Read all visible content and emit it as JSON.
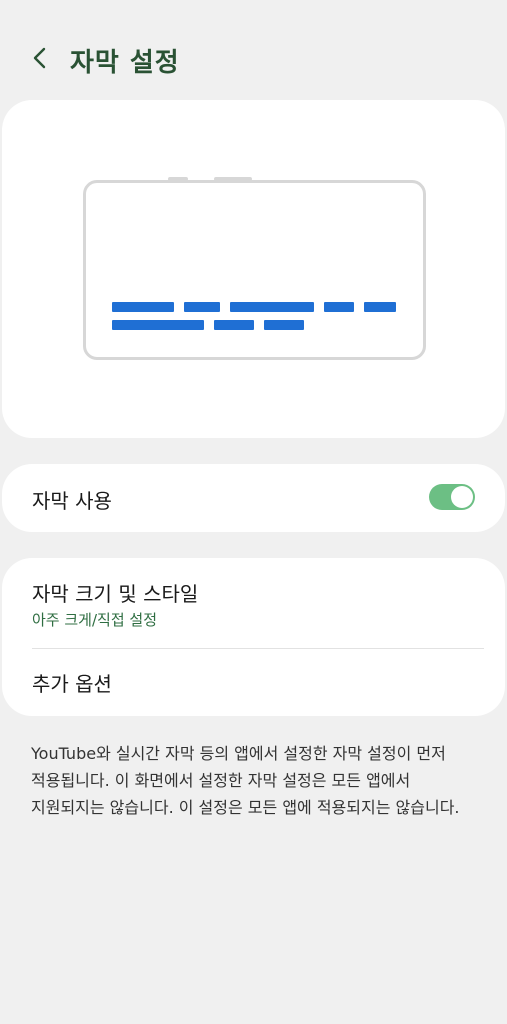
{
  "header": {
    "title": "자막 설정",
    "back_icon": "chevron-left-icon"
  },
  "toggle_row": {
    "label": "자막 사용",
    "enabled": true,
    "toggle_color": "#6cbf84"
  },
  "options": [
    {
      "label": "자막 크기 및 스타일",
      "sublabel": "아주 크게/직접 설정"
    },
    {
      "label": "추가 옵션"
    }
  ],
  "note": "YouTube와 실시간 자막 등의 앱에서 설정한 자막 설정이 먼저 적용됩니다. 이 화면에서 설정한 자막 설정은 모든 앱에서 지원되지는 않습니다. 이 설정은 모든 앱에 적용되지는 않습니다.",
  "colors": {
    "title": "#2a5234",
    "caption_bar": "#1f6fd4",
    "sublabel": "#2f6e42",
    "background": "#f0f0f0"
  }
}
